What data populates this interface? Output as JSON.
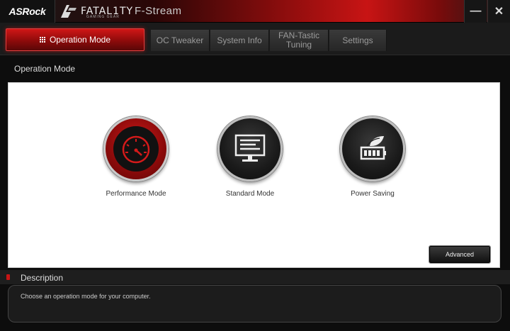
{
  "window": {
    "brand": "ASRock",
    "logo_text": "FATAL1TY",
    "logo_sub": "GAMING GEAR",
    "app_title": "F-Stream",
    "minimize_glyph": "—",
    "close_glyph": "✕"
  },
  "tabs": [
    {
      "label": "Operation Mode",
      "active": true
    },
    {
      "label": "OC Tweaker"
    },
    {
      "label": "System Info"
    },
    {
      "label": "FAN-Tastic\nTuning"
    },
    {
      "label": "Settings"
    }
  ],
  "section_title": "Operation Mode",
  "modes": [
    {
      "label": "Performance Mode",
      "icon": "speedometer-icon",
      "selected": true
    },
    {
      "label": "Standard Mode",
      "icon": "monitor-icon"
    },
    {
      "label": "Power Saving",
      "icon": "leaf-battery-icon"
    }
  ],
  "advanced_label": "Advanced",
  "description": {
    "title": "Description",
    "text": "Choose an operation mode for your computer."
  },
  "colors": {
    "accent": "#c81414",
    "background": "#0d0d0d"
  }
}
